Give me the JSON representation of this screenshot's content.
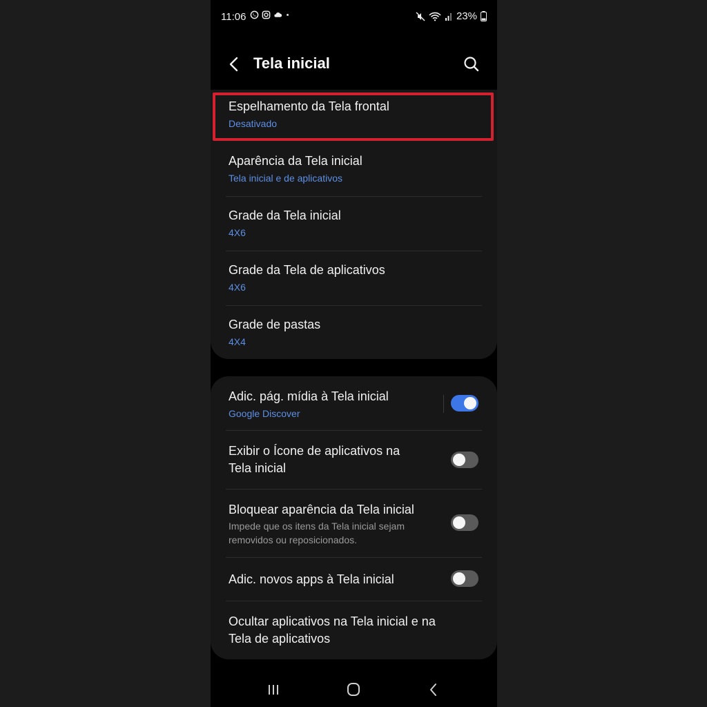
{
  "status_bar": {
    "time": "11:06",
    "battery": "23%",
    "left_icons": [
      "whatsapp-icon",
      "instagram-icon",
      "cloud-icon",
      "dot-icon"
    ],
    "right_icons": [
      "mute-icon",
      "wifi-icon",
      "signal-icon",
      "battery-icon"
    ]
  },
  "header": {
    "title": "Tela inicial",
    "back_icon": "back-arrow-icon",
    "search_icon": "search-icon"
  },
  "section1": {
    "items": [
      {
        "title": "Espelhamento da Tela frontal",
        "subtitle": "Desativado",
        "highlighted": true
      },
      {
        "title": "Aparência da Tela inicial",
        "subtitle": "Tela inicial e de aplicativos"
      },
      {
        "title": "Grade da Tela inicial",
        "subtitle": "4X6"
      },
      {
        "title": "Grade da Tela de aplicativos",
        "subtitle": "4X6"
      },
      {
        "title": "Grade de pastas",
        "subtitle": "4X4"
      }
    ]
  },
  "section2": {
    "items": [
      {
        "title": "Adic. pág. mídia à Tela inicial",
        "subtitle": "Google Discover",
        "toggle": true
      },
      {
        "title_line1": "Exibir o Ícone de aplicativos na",
        "title_line2": "Tela inicial",
        "toggle": false
      },
      {
        "title": "Bloquear aparência da Tela inicial",
        "desc_line1": "Impede que os itens da Tela inicial sejam",
        "desc_line2": "removidos ou reposicionados.",
        "toggle": false
      },
      {
        "title": "Adic. novos apps à Tela inicial",
        "toggle": false
      },
      {
        "title_line1": "Ocultar aplicativos na Tela inicial e na",
        "title_line2": "Tela de aplicativos"
      }
    ]
  },
  "nav_bar": {
    "icons": [
      "recent-apps-icon",
      "home-icon",
      "back-icon"
    ]
  },
  "colors": {
    "accent": "#3d76e6",
    "subtitle": "#5d8fe6",
    "highlight": "#d32130",
    "background": "#000000",
    "card": "#171717"
  }
}
